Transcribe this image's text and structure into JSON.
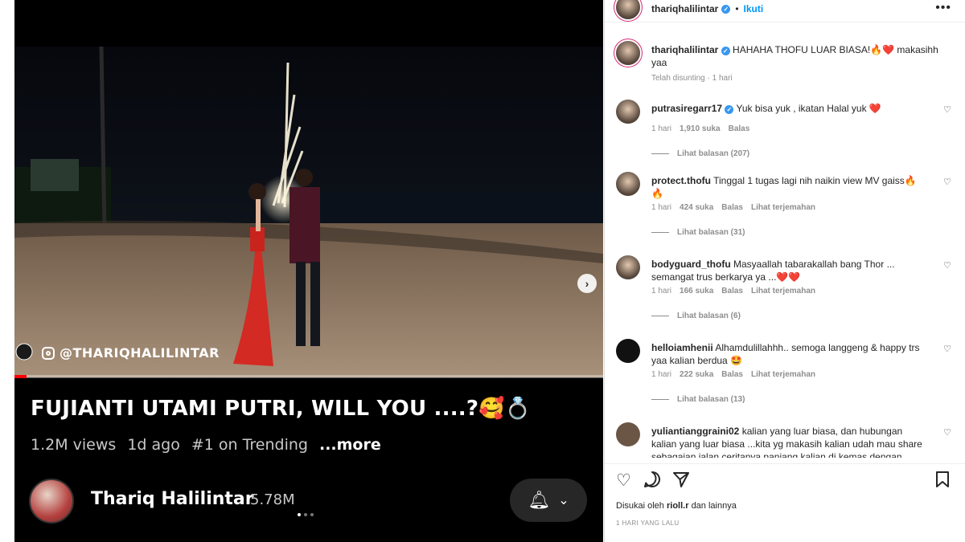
{
  "video": {
    "watermark": "@THARIQHALILINTAR",
    "progress": 0.02,
    "title": "FUJIANTI UTAMI PUTRI, WILL YOU ....?🥰💍",
    "views": "1.2M views",
    "age": "1d ago",
    "trending": "#1 on Trending",
    "more": "...more",
    "channel_name": "Thariq Halilintar",
    "subscribers": "5.78M",
    "next_icon": "chevron-right-icon",
    "bell_icon": "bell-icon"
  },
  "post": {
    "username": "thariqhalilintar",
    "dot": "•",
    "follow_label": "Ikuti",
    "more_icon": "more-horizontal-icon",
    "caption_user": "thariqhalilintar",
    "caption_text": "HAHAHA THOFU LUAR BIASA!🔥❤️ makasihh yaa",
    "caption_meta": "Telah disunting · 1 hari"
  },
  "comments": [
    {
      "user": "putrasiregarr17",
      "verified": true,
      "text": "Yuk bisa yuk , ikatan Halal yuk ❤️",
      "time": "1 hari",
      "likes": "1,910 suka",
      "reply": "Balas",
      "translate": "",
      "replies": "Lihat balasan (207)"
    },
    {
      "user": "protect.thofu",
      "verified": false,
      "text": "Tinggal 1 tugas lagi nih naikin view MV gaiss🔥🔥",
      "time": "1 hari",
      "likes": "424 suka",
      "reply": "Balas",
      "translate": "Lihat terjemahan",
      "replies": "Lihat balasan (31)"
    },
    {
      "user": "bodyguard_thofu",
      "verified": false,
      "text": "Masyaallah tabarakallah bang Thor ... semangat trus berkarya ya ...❤️❤️",
      "time": "1 hari",
      "likes": "166 suka",
      "reply": "Balas",
      "translate": "Lihat terjemahan",
      "replies": "Lihat balasan (6)"
    },
    {
      "user": "helloiamhenii",
      "verified": false,
      "text": "Alhamdulillahhh.. semoga langgeng & happy trs yaa kalian berdua 🤩",
      "time": "1 hari",
      "likes": "222 suka",
      "reply": "Balas",
      "translate": "Lihat terjemahan",
      "replies": "Lihat balasan (13)"
    },
    {
      "user": "yuliantianggraini02",
      "verified": false,
      "text": "kalian yang luar biasa, dan hubungan kalian yang luar biasa ...kita yg makasih kalian udah mau share sebagaian jalan ceritanya panjang kalian di kemas dengan cantik",
      "time": "",
      "likes": "",
      "reply": "",
      "translate": "",
      "replies": ""
    }
  ],
  "actions": {
    "like_icon": "heart-icon",
    "comment_icon": "comment-icon",
    "share_icon": "share-icon",
    "save_icon": "bookmark-icon",
    "liked_prefix": "Disukai oleh",
    "liked_user": "rioll.r",
    "liked_suffix": "dan lainnya",
    "post_time": "1 HARI YANG LALU"
  },
  "colors": {
    "link_blue": "#0095f6",
    "verified_blue": "#3897f0",
    "heart_red": "#ed4956",
    "progress_red": "#ff0000"
  }
}
